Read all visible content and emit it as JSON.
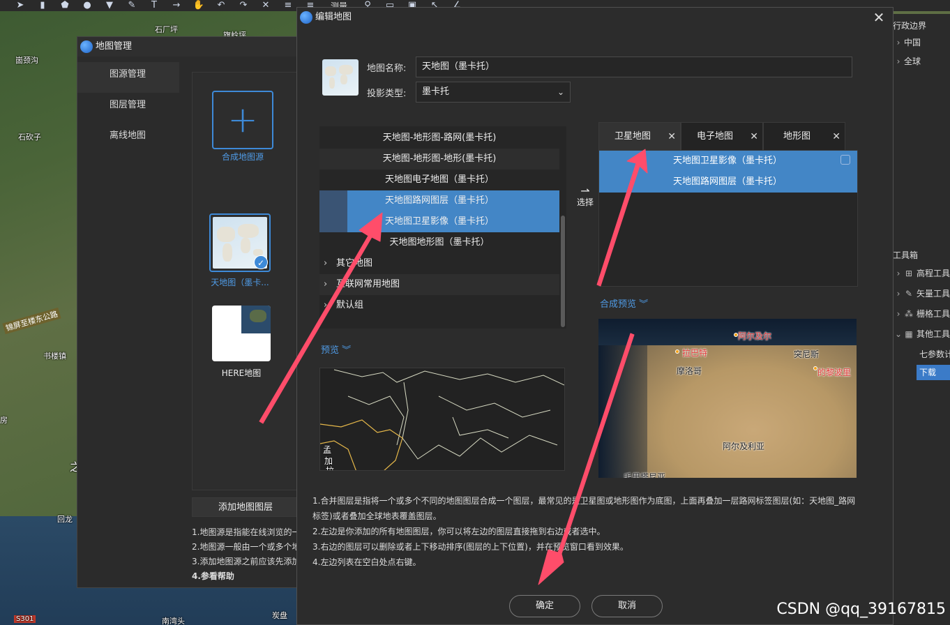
{
  "toolbar": {
    "measure_label": "测量"
  },
  "background_map": {
    "labels": [
      "石厂坪",
      "旗岭坪",
      "崮颈沟",
      "石砍子",
      "锦屏至楼东公路",
      "书楼镇",
      "回龙",
      "南湾头",
      "炭盘",
      "S301",
      "房",
      "之"
    ]
  },
  "right_panel": {
    "items": [
      {
        "label": "行政边界"
      },
      {
        "label": "中国"
      },
      {
        "label": "全球"
      },
      {
        "label": "工具箱"
      },
      {
        "label": "高程工具"
      },
      {
        "label": "矢量工具"
      },
      {
        "label": "栅格工具"
      },
      {
        "label": "其他工具"
      },
      {
        "label": "七参数计算"
      },
      {
        "label": "下载"
      }
    ]
  },
  "map_manager": {
    "title": "地图管理",
    "nav": [
      "图源管理",
      "图层管理",
      "离线地图"
    ],
    "tiles": [
      {
        "label": "合成地图源"
      },
      {
        "label": "天地图（墨卡..."
      },
      {
        "label": "HERE地图"
      }
    ],
    "add_layer": "添加地图图层",
    "help": [
      "1.地图源是指能在线浏览的一",
      "2.地图源一般由一个或多个地",
      "3.添加地图源之前应该先添加",
      "4.参看帮助"
    ]
  },
  "dialog": {
    "title": "编辑地图",
    "name_label": "地图名称:",
    "name_value": "天地图（墨卡托）",
    "proj_label": "投影类型:",
    "proj_value": "墨卡托",
    "left_list": [
      {
        "label": "天地图-地形图-路网(墨卡托)",
        "state": "normal"
      },
      {
        "label": "天地图-地形图-地形(墨卡托)",
        "state": "alt"
      },
      {
        "label": "天地图电子地图（墨卡托）",
        "state": "normal"
      },
      {
        "label": "天地图路网图层（墨卡托）",
        "state": "selected"
      },
      {
        "label": "天地图卫星影像（墨卡托）",
        "state": "selected"
      },
      {
        "label": "天地图地形图（墨卡托）",
        "state": "normal"
      }
    ],
    "groups": [
      "其它地图",
      "互联网常用地图",
      "默认组"
    ],
    "select_label": "选择",
    "tabs": [
      "卫星地图",
      "电子地图",
      "地形图"
    ],
    "right_list": [
      "天地图卫星影像（墨卡托）",
      "天地图路网图层（墨卡托）"
    ],
    "preview_label": "预览",
    "composite_preview_label": "合成预览",
    "left_preview_labels": [
      "孟",
      "加",
      "拉"
    ],
    "preview_map_labels": {
      "dark": [
        "摩洛哥",
        "突尼斯",
        "阿尔及利亚",
        "毛里塔尼亚"
      ],
      "red": [
        "拉巴特",
        "阿尔及尔",
        "的黎波里"
      ]
    },
    "notes": [
      "1.合并图层是指将一个或多个不同的地图图层合成一个图层，最常见的是卫星图或地形图作为底图，上面再叠加一层路网标签图层(如：天地图_路网",
      "标签)或者叠加全球地表覆盖图层。",
      "2.左边是你添加的所有地图图层，你可以将左边的图层直接拖到右边或者选中。",
      "3.右边的图层可以删除或者上下移动排序(图层的上下位置)，并在预览窗口看到效果。",
      "4.左边列表在空白处点右键。"
    ],
    "ok_label": "确定",
    "cancel_label": "取消"
  },
  "watermark": "CSDN @qq_39167815",
  "colors": {
    "accent": "#4386c6",
    "arrow": "#ff4d6a",
    "link": "#4f9be6"
  }
}
